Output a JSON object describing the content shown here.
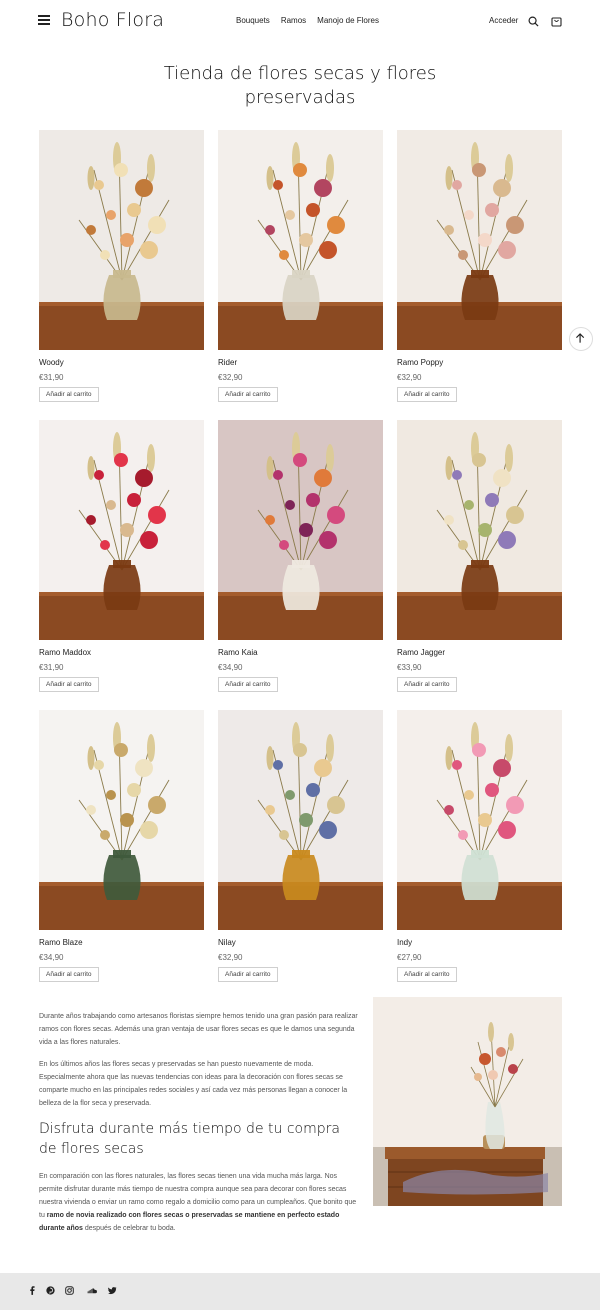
{
  "header": {
    "logo": "Boho Flora",
    "nav": [
      "Bouquets",
      "Ramos",
      "Manojo de Flores"
    ],
    "login": "Acceder"
  },
  "page_title": "Tienda de flores secas y flores preservadas",
  "products": [
    {
      "name": "Woody",
      "price": "€31,90",
      "button": "Añadir al carrito",
      "vase": "#c8b98e"
    },
    {
      "name": "Rider",
      "price": "€32,90",
      "button": "Añadir al carrito",
      "vase": "#d9d4c4"
    },
    {
      "name": "Ramo Poppy",
      "price": "€32,90",
      "button": "Añadir al carrito",
      "vase": "#7a3a12"
    },
    {
      "name": "Ramo Maddox",
      "price": "€31,90",
      "button": "Añadir al carrito",
      "vase": "#7a3a12"
    },
    {
      "name": "Ramo Kaia",
      "price": "€34,90",
      "button": "Añadir al carrito",
      "vase": "#efe9e0"
    },
    {
      "name": "Ramo Jagger",
      "price": "€33,90",
      "button": "Añadir al carrito",
      "vase": "#7a3a12"
    },
    {
      "name": "Ramo Blaze",
      "price": "€34,90",
      "button": "Añadir al carrito",
      "vase": "#3f5a3c"
    },
    {
      "name": "Nilay",
      "price": "€32,90",
      "button": "Añadir al carrito",
      "vase": "#c98a1e"
    },
    {
      "name": "Indy",
      "price": "€27,90",
      "button": "Añadir al carrito",
      "vase": "#cfe0d4"
    }
  ],
  "content": {
    "para1": "Durante años trabajando como artesanos floristas siempre hemos tenido una gran pasión para realizar ramos con flores secas. Además una gran ventaja de usar flores secas es que le damos una segunda vida a las flores naturales.",
    "para2": "En los últimos años las flores secas y preservadas se han puesto nuevamente de moda. Especialmente ahora que las nuevas tendencias con ideas para la decoración con flores secas se comparte mucho en las principales redes sociales y así cada vez más personas llegan a conocer la belleza de la flor seca y preservada.",
    "heading": "Disfruta durante más tiempo de tu compra de flores secas",
    "para3_start": "En comparación con las flores naturales, las flores secas tienen una vida mucha más larga. Nos permite disfrutar durante más tiempo de nuestra compra aunque sea para decorar con flores secas nuestra vivienda o enviar un ramo como regalo a domicilio como para un cumpleaños. Que bonito que tu ",
    "para3_bold": "ramo de novia realizado con flores secas o preservadas se mantiene en perfecto estado durante años",
    "para3_end": " después de celebrar tu boda."
  },
  "icons": {
    "menu": "hamburger-icon",
    "search": "search-icon",
    "cart": "shopping-bag-icon",
    "scroll_top": "arrow-up-icon",
    "social": [
      "facebook-icon",
      "pinterest-icon",
      "instagram-icon",
      "soundcloud-icon",
      "twitter-icon"
    ]
  },
  "colors": {
    "footer_bg": "#e8e8e8",
    "text": "#222222",
    "wall": "#f2ece6",
    "table": "#8b4a22"
  }
}
